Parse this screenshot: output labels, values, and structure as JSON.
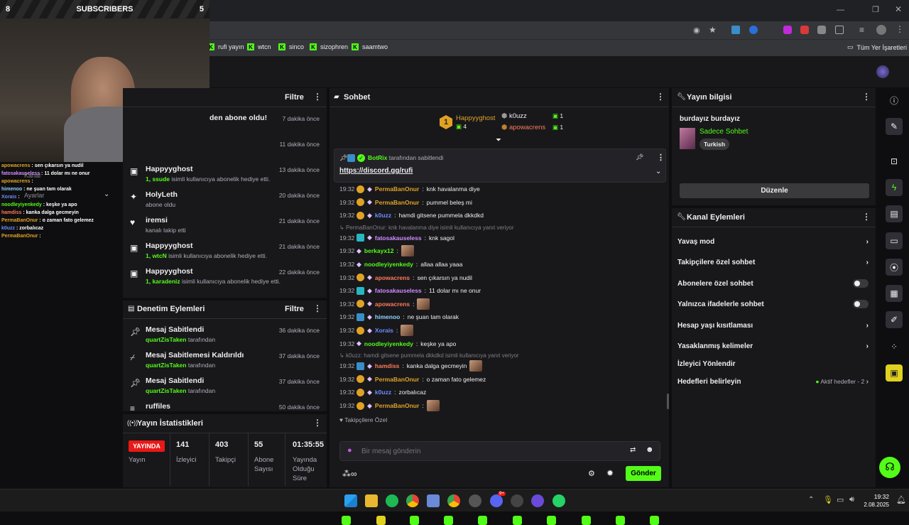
{
  "overlay": {
    "counter_left": "8",
    "title": "SUBSCRIBERS",
    "counter_right": "5",
    "chat": [
      {
        "user": "apowacrens",
        "text": " : sen çıkarsın ya nudil"
      },
      {
        "user": "fatosakauseless",
        "text": " : 11 dolar mı ne onur"
      },
      {
        "user": "apowacrens",
        "text": " :"
      },
      {
        "user": "himenoo",
        "text": " : ne şuan tam olarak"
      },
      {
        "user": "Xorais",
        "text": " :"
      },
      {
        "user": "noodleyiyenkedy",
        "text": " : keşke ya apo"
      },
      {
        "user": "hamdiss",
        "text": " : kanka dalga gecmeyin"
      },
      {
        "user": "PermaBanOnur",
        "text": " : o zaman fato gelemez"
      },
      {
        "user": "k0uzz",
        "text": " : zorbalıcaz"
      },
      {
        "user": "PermaBanOnur",
        "text": " :"
      }
    ],
    "kanal_label": "Kanal",
    "ayarlar_label": "Ayarlar"
  },
  "bookmarks": [
    "rufi yayın",
    "wtcn",
    "sinco",
    "sizophren",
    "saamtwo"
  ],
  "bookmarks_right": "Tüm Yer İşaretleri",
  "activity": {
    "filter_label": "Filtre",
    "items": [
      {
        "name": "",
        "sub": "den abone oldu!",
        "time": "7 dakika önce",
        "icon": "star-icon"
      },
      {
        "name": "",
        "sub": "",
        "time": "11 dakika önce",
        "icon": "star-icon"
      },
      {
        "name": "Happyyghost",
        "sub_green": "1, ssude",
        "sub": " isimli kullanıcıya abonelik hediye etti.",
        "time": "13 dakika önce",
        "icon": "gift-icon"
      },
      {
        "name": "HolyLeth",
        "sub": "abone oldu",
        "time": "20 dakika önce",
        "icon": "star-icon"
      },
      {
        "name": "iremsi",
        "sub": "kanalı takip etti",
        "time": "21 dakika önce",
        "icon": "heart-icon"
      },
      {
        "name": "Happyyghost",
        "sub_green": "1, wtcN",
        "sub": " isimli kullanıcıya abonelik hediye etti.",
        "time": "21 dakika önce",
        "icon": "gift-icon"
      },
      {
        "name": "Happyyghost",
        "sub_green": "1, karadeniz",
        "sub": " isimli kullanıcıya abonelik hediye etti.",
        "time": "22 dakika önce",
        "icon": "gift-icon"
      }
    ]
  },
  "mod": {
    "title": "Denetim Eylemleri",
    "filter_label": "Filtre",
    "items": [
      {
        "name": "Mesaj Sabitlendi",
        "user": "quartZisTaken",
        "suffix": " tarafından",
        "time": "36 dakika önce",
        "icon": "pin-icon"
      },
      {
        "name": "Mesaj Sabitlemesi Kaldırıldı",
        "user": "quartZisTaken",
        "suffix": " tarafından",
        "time": "37 dakika önce",
        "icon": "unpin-icon"
      },
      {
        "name": "Mesaj Sabitlendi",
        "user": "quartZisTaken",
        "suffix": " tarafından",
        "time": "37 dakika önce",
        "icon": "pin-icon"
      },
      {
        "name": "ruffiles",
        "user": "",
        "suffix": "",
        "time": "50 dakika önce",
        "icon": "list-icon"
      }
    ]
  },
  "stats": {
    "title": "Yayın İstatistikleri",
    "live_badge": "YAYINDA",
    "live_label": "Yayın",
    "items": [
      {
        "value": "141",
        "label": "İzleyici"
      },
      {
        "value": "403",
        "label": "Takipçi"
      },
      {
        "value": "55",
        "label": "Abone Sayısı"
      },
      {
        "value": "01:35:55",
        "label": "Yayında Olduğu Süre"
      }
    ]
  },
  "chat": {
    "title": "Sohbet",
    "leaderboard": [
      {
        "rank": "1",
        "name": "Happyyghost",
        "count": "4"
      },
      {
        "name": "k0uzz",
        "count": "1"
      },
      {
        "name": "apowacrens",
        "count": "1"
      }
    ],
    "pinned": {
      "by_user": "BotRix",
      "by_suffix": "tarafından sabitlendi",
      "link": "https://discord.gg/rufi"
    },
    "messages": [
      {
        "time": "19:32",
        "badge": "gold",
        "user": "PermaBanOnur",
        "color": "#e0a226",
        "text": "knk havalanma diye"
      },
      {
        "time": "19:32",
        "badge": "gold",
        "user": "PermaBanOnur",
        "color": "#e0a226",
        "text": "pummel beleş mi"
      },
      {
        "time": "19:32",
        "badge": "gold",
        "user": "k0uzz",
        "color": "#6f8cff",
        "text": "hamdi gitsene pummela dkkdkd"
      },
      {
        "reply": "PermaBanOnur: knk havalanma diye isimli kullanıcıya yanıt veriyor"
      },
      {
        "time": "19:32",
        "badge": "teal",
        "user": "fatosakauseless",
        "color": "#d08cff",
        "text": "knk sagol"
      },
      {
        "time": "19:32",
        "badge": "",
        "user": "berkayx12",
        "color": "#53fc18",
        "text": "",
        "emote": true
      },
      {
        "time": "19:32",
        "badge": "",
        "user": "noodleyiyenkedy",
        "color": "#53fc18",
        "text": "allaa allaa yaaa"
      },
      {
        "time": "19:32",
        "badge": "gold",
        "user": "apowacrens",
        "color": "#ff7a59",
        "text": "sen çıkarsın ya nudil"
      },
      {
        "time": "19:32",
        "badge": "teal",
        "user": "fatosakauseless",
        "color": "#d08cff",
        "text": "11 dolar mı ne onur"
      },
      {
        "time": "19:32",
        "badge": "gold",
        "user": "apowacrens",
        "color": "#ff7a59",
        "text": "",
        "emote": true
      },
      {
        "time": "19:32",
        "badge": "blue",
        "user": "himenoo",
        "color": "#8fd4ff",
        "text": "ne şuan tam olarak"
      },
      {
        "time": "19:32",
        "badge": "gold",
        "user": "Xorais",
        "color": "#6f8cff",
        "text": "",
        "emote": true
      },
      {
        "time": "19:32",
        "badge": "",
        "user": "noodleyiyenkedy",
        "color": "#53fc18",
        "text": "keşke ya apo"
      },
      {
        "reply": "k0uzz: hamdi gitsene pummela dkkdkd isimli kullanıcıya yanıt veriyor"
      },
      {
        "time": "19:32",
        "badge": "blue",
        "user": "hamdiss",
        "color": "#ff7a59",
        "text": "kanka dalga gecmeyin",
        "emote": true
      },
      {
        "time": "19:32",
        "badge": "gold",
        "user": "PermaBanOnur",
        "color": "#e0a226",
        "text": "o zaman fato gelemez"
      },
      {
        "time": "19:32",
        "badge": "gold",
        "user": "k0uzz",
        "color": "#6f8cff",
        "text": "zorbalıcaz"
      },
      {
        "time": "19:32",
        "badge": "gold",
        "user": "PermaBanOnur",
        "color": "#e0a226",
        "text": "",
        "emote": true
      }
    ],
    "followers_only": "Takipçilere Özel",
    "input_placeholder": "Bir mesaj gönderin",
    "send_label": "Gönder"
  },
  "stream_info": {
    "title": "Yayın bilgisi",
    "stream_title": "burdayız burdayız",
    "category": "Sadece Sohbet",
    "tag": "Turkish",
    "edit_label": "Düzenle"
  },
  "channel_actions": {
    "title": "Kanal Eylemleri",
    "items": [
      {
        "label": "Yavaş mod",
        "control": "chevron"
      },
      {
        "label": "Takipçilere özel sohbet",
        "control": "chevron"
      },
      {
        "label": "Abonelere özel sohbet",
        "control": "toggle"
      },
      {
        "label": "Yalnızca ifadelerle sohbet",
        "control": "toggle"
      },
      {
        "label": "Hesap yaşı kısıtlaması",
        "control": "chevron"
      },
      {
        "label": "Yasaklanmış kelimeler",
        "control": "chevron"
      },
      {
        "label": "İzleyici Yönlendir",
        "control": "none"
      },
      {
        "label": "Hedefleri belirleyin",
        "control": "chevron",
        "extra": "Aktif hedefler - 2"
      }
    ]
  },
  "taskbar": {
    "time": "19:32",
    "date": "2.08.2025",
    "notif_badge": "9+"
  },
  "colors": {
    "accent": "#53fc18",
    "live": "#e91916",
    "panel": "#18181b",
    "bg": "#0e0e10"
  }
}
